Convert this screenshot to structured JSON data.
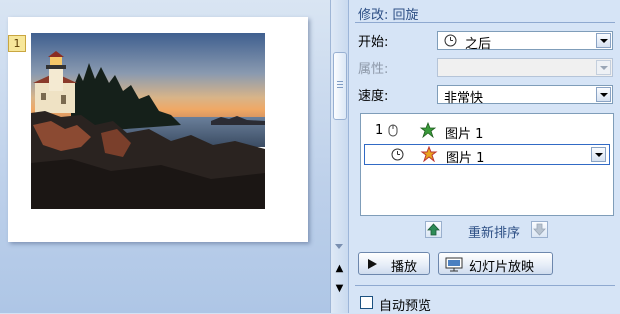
{
  "slide": {
    "animation_tag": "1",
    "image_alt": "lighthouse photo"
  },
  "pane": {
    "title": "修改: 回旋",
    "start": {
      "label": "开始:",
      "value": "之后",
      "icon": "clock-icon"
    },
    "property": {
      "label": "属性:",
      "value": ""
    },
    "speed": {
      "label": "速度:",
      "value": "非常快"
    },
    "animation_list": [
      {
        "number": "1",
        "trigger_icon": "mouse-click-icon",
        "effect_icon": "entrance-effect-icon",
        "name": "图片 1",
        "selected": false
      },
      {
        "number": "",
        "trigger_icon": "clock-icon",
        "effect_icon": "emphasis-effect-icon",
        "name": "图片 1",
        "selected": true
      }
    ],
    "reorder_label": "重新排序",
    "play_button": "播放",
    "slideshow_button": "幻灯片放映",
    "autopreview": {
      "label": "自动预览",
      "checked": false
    }
  },
  "colors": {
    "pane_background": "#d6e4f6",
    "title_blue": "#2d4f85",
    "selection_border": "#316ac5"
  }
}
